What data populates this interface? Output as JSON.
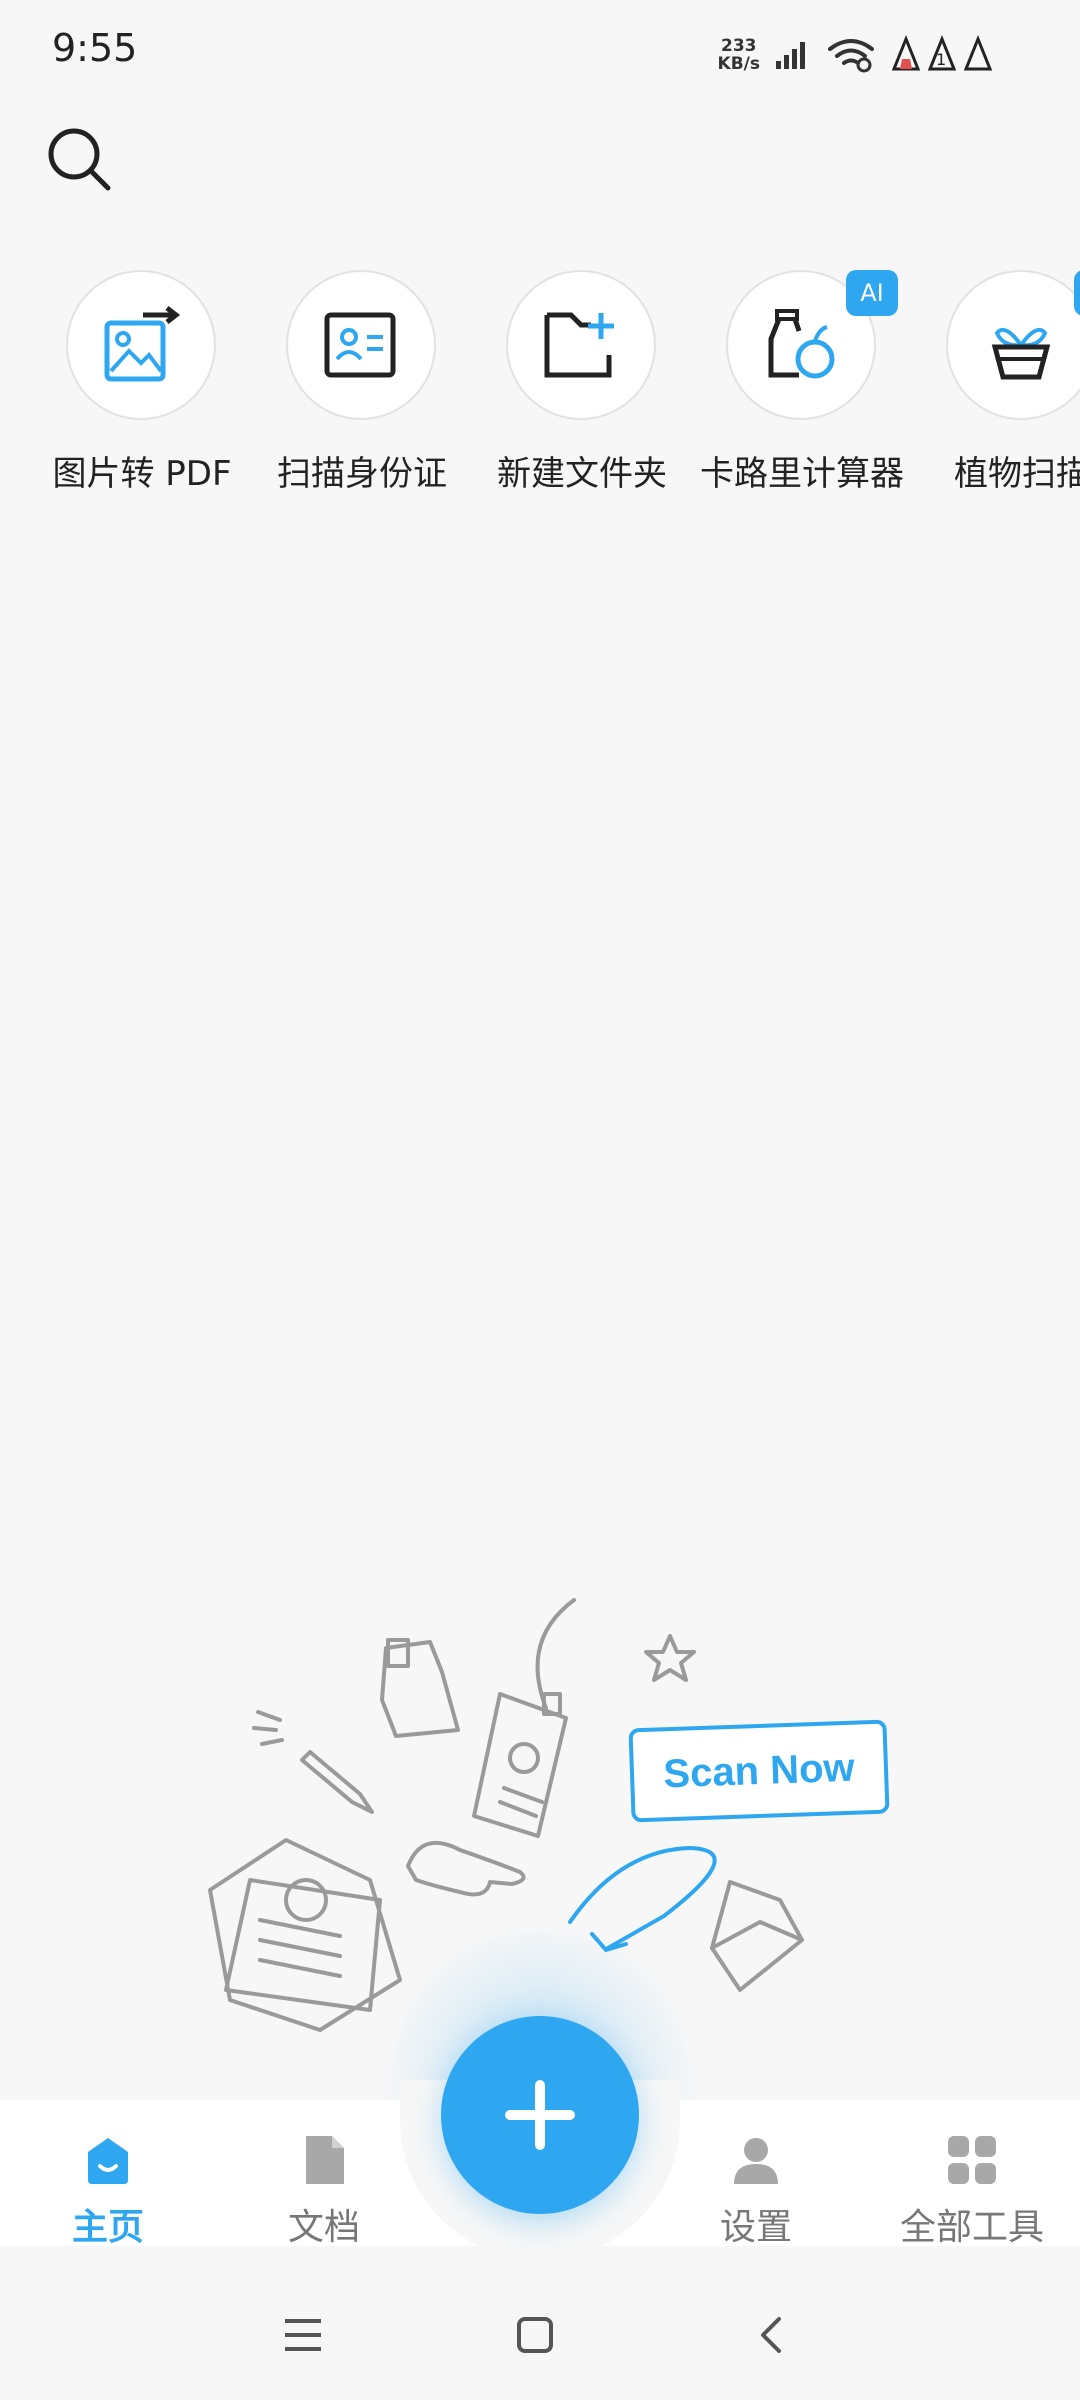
{
  "status_bar": {
    "time": "9:55",
    "net_speed_value": "233",
    "net_speed_unit": "KB/s",
    "notification_badge": "1"
  },
  "search": {
    "icon": "search-icon"
  },
  "quick_tools": [
    {
      "label": "图片转 PDF",
      "icon": "image-to-pdf-icon"
    },
    {
      "label": "扫描身份证",
      "icon": "id-card-icon"
    },
    {
      "label": "新建文件夹",
      "icon": "new-folder-icon"
    },
    {
      "label": "卡路里计算器",
      "icon": "calorie-icon",
      "badge": "AI"
    },
    {
      "label": "植物扫描",
      "icon": "plant-icon"
    }
  ],
  "illustration": {
    "cta": "Scan Now"
  },
  "bottom_nav": [
    {
      "label": "主页",
      "icon": "home-icon",
      "active": true
    },
    {
      "label": "文档",
      "icon": "document-icon",
      "active": false
    },
    {
      "label": "设置",
      "icon": "user-icon",
      "active": false
    },
    {
      "label": "全部工具",
      "icon": "grid-icon",
      "active": false
    }
  ],
  "fab": {
    "icon": "plus-icon"
  },
  "system_nav": [
    "menu-icon",
    "home-square-icon",
    "back-icon"
  ],
  "colors": {
    "accent": "#2ea7f0",
    "background": "#f7f7f7",
    "text": "#222222",
    "inactive": "#777777"
  }
}
